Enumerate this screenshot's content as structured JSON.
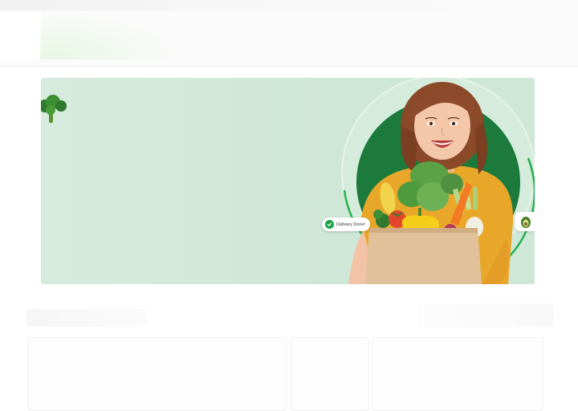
{
  "hero": {
    "delivery_badge": "Delivery Done!",
    "colors": {
      "banner_bg": "#cfe7d7",
      "circle_green": "#1b7a3c",
      "ring_green": "#22b14c",
      "check_green": "#1aa34a"
    },
    "icons": [
      "broccoli-icon",
      "check-icon",
      "avocado-icon"
    ]
  }
}
